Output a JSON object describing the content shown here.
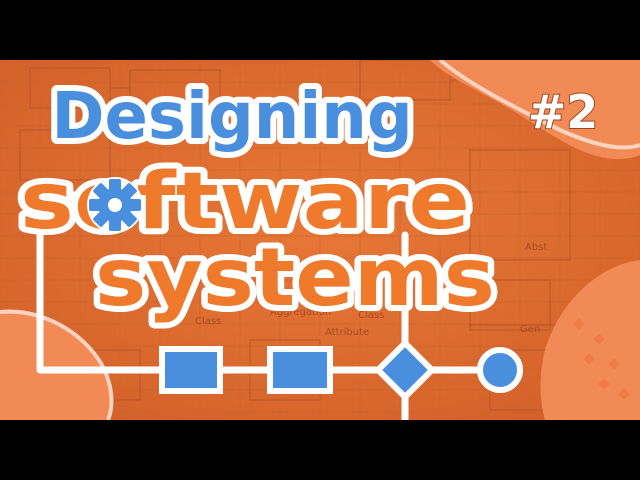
{
  "thumbnail": {
    "episode_label": "#2",
    "title_line1": "Designing",
    "title_line2": "software",
    "title_line3": "systems",
    "bg_labels": [
      "Aggregation",
      "Attribute",
      "Class",
      "Class",
      "Abst",
      "Gen"
    ],
    "colors": {
      "bg_orange": "#e0702e",
      "blue": "#4a8fde",
      "orange_text": "#f07a2c",
      "white": "#ffffff",
      "dark_frame": "#000000"
    },
    "icons": [
      "gear-icon",
      "rectangle-shape",
      "diamond-shape",
      "circle-shape"
    ]
  }
}
